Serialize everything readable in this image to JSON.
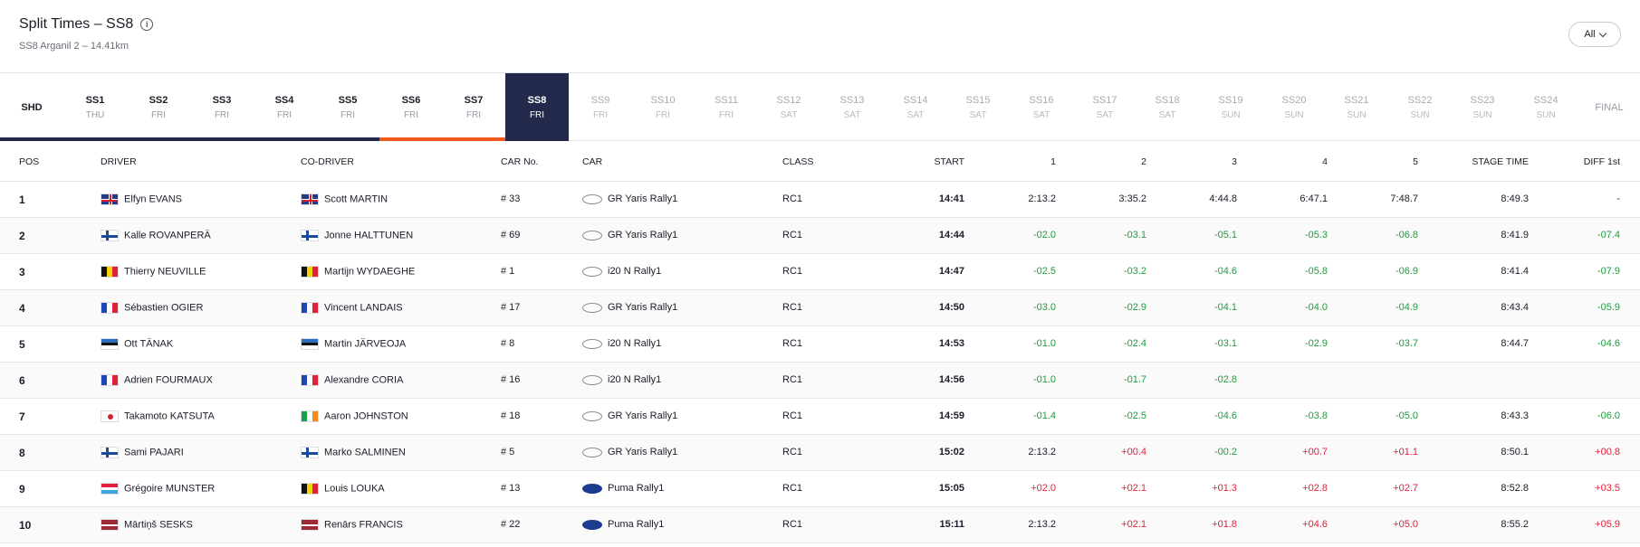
{
  "header": {
    "title": "Split Times – SS8",
    "info_icon": "info-icon",
    "subtitle": "SS8 Arganil 2 – 14.41km",
    "filter_label": "All"
  },
  "stages": [
    {
      "name": "SHD",
      "day": ""
    },
    {
      "name": "SS1",
      "day": "THU"
    },
    {
      "name": "SS2",
      "day": "FRI"
    },
    {
      "name": "SS3",
      "day": "FRI"
    },
    {
      "name": "SS4",
      "day": "FRI"
    },
    {
      "name": "SS5",
      "day": "FRI"
    },
    {
      "name": "SS6",
      "day": "FRI"
    },
    {
      "name": "SS7",
      "day": "FRI"
    },
    {
      "name": "SS8",
      "day": "FRI"
    },
    {
      "name": "SS9",
      "day": "FRI"
    },
    {
      "name": "SS10",
      "day": "FRI"
    },
    {
      "name": "SS11",
      "day": "FRI"
    },
    {
      "name": "SS12",
      "day": "SAT"
    },
    {
      "name": "SS13",
      "day": "SAT"
    },
    {
      "name": "SS14",
      "day": "SAT"
    },
    {
      "name": "SS15",
      "day": "SAT"
    },
    {
      "name": "SS16",
      "day": "SAT"
    },
    {
      "name": "SS17",
      "day": "SAT"
    },
    {
      "name": "SS18",
      "day": "SAT"
    },
    {
      "name": "SS19",
      "day": "SUN"
    },
    {
      "name": "SS20",
      "day": "SUN"
    },
    {
      "name": "SS21",
      "day": "SUN"
    },
    {
      "name": "SS22",
      "day": "SUN"
    },
    {
      "name": "SS23",
      "day": "SUN"
    },
    {
      "name": "SS24",
      "day": "SUN"
    },
    {
      "name": "FINAL",
      "day": ""
    }
  ],
  "active_stage": "SS8",
  "columns": [
    "POS",
    "DRIVER",
    "CO-DRIVER",
    "CAR No.",
    "CAR",
    "CLASS",
    "START",
    "1",
    "2",
    "3",
    "4",
    "5",
    "STAGE TIME",
    "DIFF 1st"
  ],
  "rows": [
    {
      "pos": "1",
      "driver": "Elfyn EVANS",
      "driver_flag": "gb",
      "codriver": "Scott MARTIN",
      "codriver_flag": "gb",
      "car_no": "# 33",
      "car": "GR Yaris Rally1",
      "brand": "toyota",
      "class": "RC1",
      "start": "14:41",
      "s1": "2:13.2",
      "s2": "3:35.2",
      "s3": "4:44.8",
      "s4": "6:47.1",
      "s5": "7:48.7",
      "stage_time": "8:49.3",
      "diff": "-"
    },
    {
      "pos": "2",
      "driver": "Kalle ROVANPERÄ",
      "driver_flag": "fi",
      "codriver": "Jonne HALTTUNEN",
      "codriver_flag": "fi",
      "car_no": "# 69",
      "car": "GR Yaris Rally1",
      "brand": "toyota",
      "class": "RC1",
      "start": "14:44",
      "s1": "-02.0",
      "s2": "-03.1",
      "s3": "-05.1",
      "s4": "-05.3",
      "s5": "-06.8",
      "stage_time": "8:41.9",
      "diff": "-07.4"
    },
    {
      "pos": "3",
      "driver": "Thierry NEUVILLE",
      "driver_flag": "be",
      "codriver": "Martijn WYDAEGHE",
      "codriver_flag": "be",
      "car_no": "# 1",
      "car": "i20 N Rally1",
      "brand": "hyundai",
      "class": "RC1",
      "start": "14:47",
      "s1": "-02.5",
      "s2": "-03.2",
      "s3": "-04.6",
      "s4": "-05.8",
      "s5": "-06.9",
      "stage_time": "8:41.4",
      "diff": "-07.9"
    },
    {
      "pos": "4",
      "driver": "Sébastien OGIER",
      "driver_flag": "fr",
      "codriver": "Vincent LANDAIS",
      "codriver_flag": "fr",
      "car_no": "# 17",
      "car": "GR Yaris Rally1",
      "brand": "toyota",
      "class": "RC1",
      "start": "14:50",
      "s1": "-03.0",
      "s2": "-02.9",
      "s3": "-04.1",
      "s4": "-04.0",
      "s5": "-04.9",
      "stage_time": "8:43.4",
      "diff": "-05.9"
    },
    {
      "pos": "5",
      "driver": "Ott TÄNAK",
      "driver_flag": "ee",
      "codriver": "Martin JÄRVEOJA",
      "codriver_flag": "ee",
      "car_no": "# 8",
      "car": "i20 N Rally1",
      "brand": "hyundai",
      "class": "RC1",
      "start": "14:53",
      "s1": "-01.0",
      "s2": "-02.4",
      "s3": "-03.1",
      "s4": "-02.9",
      "s5": "-03.7",
      "stage_time": "8:44.7",
      "diff": "-04.6"
    },
    {
      "pos": "6",
      "driver": "Adrien FOURMAUX",
      "driver_flag": "fr",
      "codriver": "Alexandre CORIA",
      "codriver_flag": "fr",
      "car_no": "# 16",
      "car": "i20 N Rally1",
      "brand": "hyundai",
      "class": "RC1",
      "start": "14:56",
      "s1": "-01.0",
      "s2": "-01.7",
      "s3": "-02.8",
      "s4": "",
      "s5": "",
      "stage_time": "",
      "diff": ""
    },
    {
      "pos": "7",
      "driver": "Takamoto KATSUTA",
      "driver_flag": "jp",
      "codriver": "Aaron JOHNSTON",
      "codriver_flag": "ie",
      "car_no": "# 18",
      "car": "GR Yaris Rally1",
      "brand": "toyota",
      "class": "RC1",
      "start": "14:59",
      "s1": "-01.4",
      "s2": "-02.5",
      "s3": "-04.6",
      "s4": "-03.8",
      "s5": "-05.0",
      "stage_time": "8:43.3",
      "diff": "-06.0"
    },
    {
      "pos": "8",
      "driver": "Sami PAJARI",
      "driver_flag": "fi",
      "codriver": "Marko SALMINEN",
      "codriver_flag": "fi",
      "car_no": "# 5",
      "car": "GR Yaris Rally1",
      "brand": "toyota",
      "class": "RC1",
      "start": "15:02",
      "s1": "2:13.2",
      "s2": "+00.4",
      "s3": "-00.2",
      "s4": "+00.7",
      "s5": "+01.1",
      "stage_time": "8:50.1",
      "diff": "+00.8"
    },
    {
      "pos": "9",
      "driver": "Grégoire MUNSTER",
      "driver_flag": "lu",
      "codriver": "Louis LOUKA",
      "codriver_flag": "be",
      "car_no": "# 13",
      "car": "Puma Rally1",
      "brand": "ford",
      "class": "RC1",
      "start": "15:05",
      "s1": "+02.0",
      "s2": "+02.1",
      "s3": "+01.3",
      "s4": "+02.8",
      "s5": "+02.7",
      "stage_time": "8:52.8",
      "diff": "+03.5"
    },
    {
      "pos": "10",
      "driver": "Mārtiņš SESKS",
      "driver_flag": "lv",
      "codriver": "Renārs FRANCIS",
      "codriver_flag": "lv",
      "car_no": "# 22",
      "car": "Puma Rally1",
      "brand": "ford",
      "class": "RC1",
      "start": "15:11",
      "s1": "2:13.2",
      "s2": "+02.1",
      "s3": "+01.8",
      "s4": "+04.6",
      "s5": "+05.0",
      "stage_time": "8:55.2",
      "diff": "+05.9"
    }
  ],
  "colors": {
    "navy": "#23294a",
    "orange": "#f05a1e",
    "green": "#1f9d3c",
    "red": "#e0213c"
  }
}
